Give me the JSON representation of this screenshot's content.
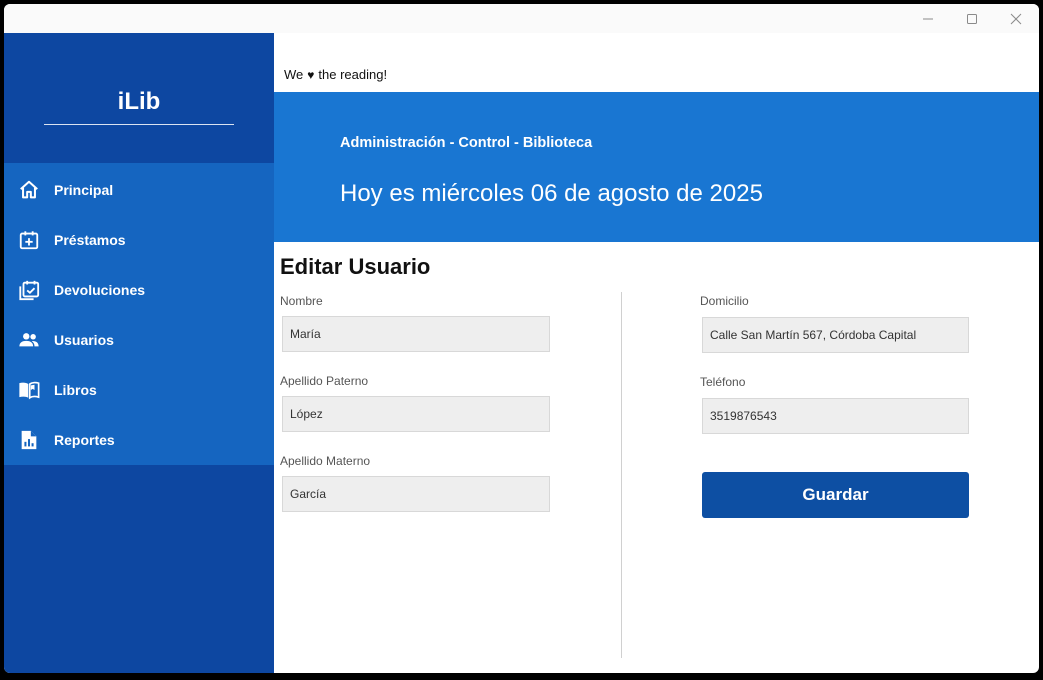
{
  "app": {
    "brand": "iLib",
    "tagline_prefix": "We",
    "tagline_suffix": "the reading!"
  },
  "titlebar": {
    "minimize_icon": "minimize-icon",
    "maximize_icon": "maximize-icon",
    "close_icon": "close-icon"
  },
  "sidebar": {
    "items": [
      {
        "label": "Principal",
        "icon": "home-icon"
      },
      {
        "label": "Préstamos",
        "icon": "calendar-plus-icon"
      },
      {
        "label": "Devoluciones",
        "icon": "calendar-check-icon"
      },
      {
        "label": "Usuarios",
        "icon": "users-icon"
      },
      {
        "label": "Libros",
        "icon": "book-open-icon"
      },
      {
        "label": "Reportes",
        "icon": "report-icon"
      }
    ]
  },
  "banner": {
    "subtitle": "Administración - Control - Biblioteca",
    "date": "Hoy es miércoles 06 de agosto de 2025"
  },
  "form": {
    "title": "Editar Usuario",
    "nombre_label": "Nombre",
    "nombre_value": "María",
    "apellido_paterno_label": "Apellido Paterno",
    "apellido_paterno_value": "López",
    "apellido_materno_label": "Apellido Materno",
    "apellido_materno_value": "García",
    "domicilio_label": "Domicilio",
    "domicilio_value": "Calle San Martín 567, Córdoba Capital",
    "telefono_label": "Teléfono",
    "telefono_value": "3519876543",
    "save_label": "Guardar"
  },
  "colors": {
    "sidebar_dark": "#0d47a1",
    "sidebar_nav": "#1565c0",
    "banner": "#1976d2",
    "button": "#0d4fa3"
  }
}
